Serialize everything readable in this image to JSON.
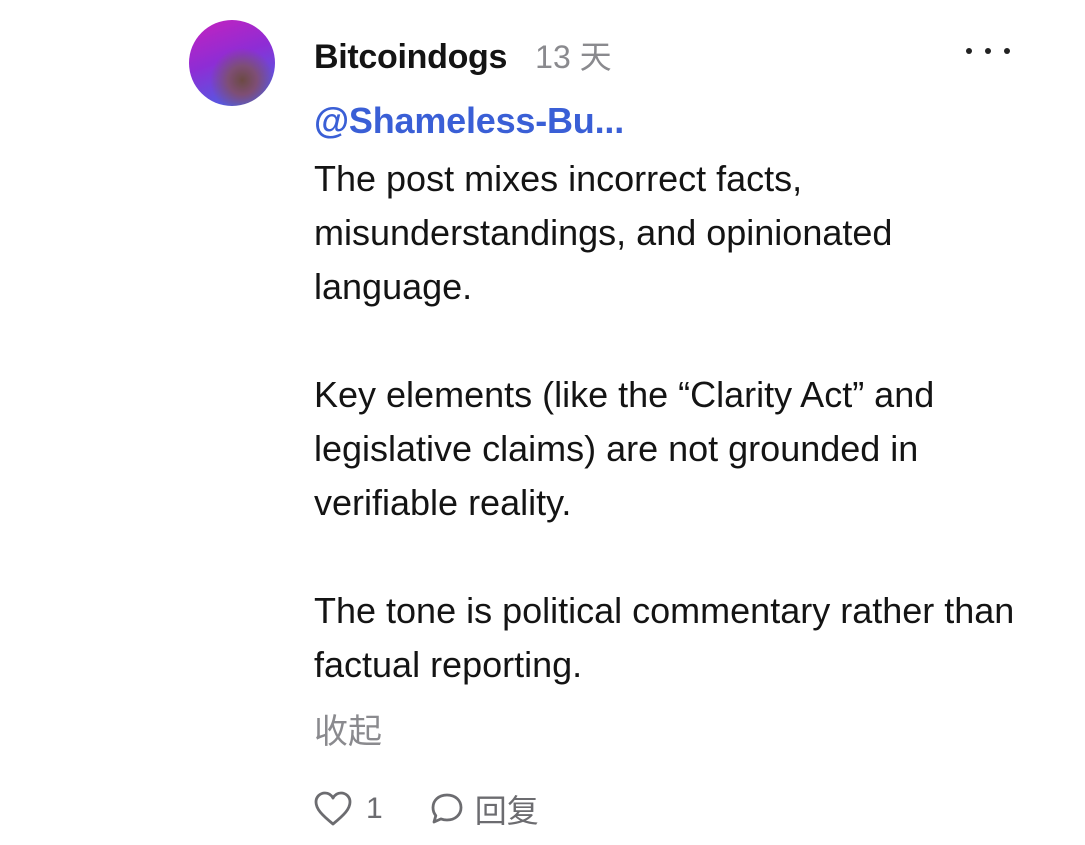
{
  "comment": {
    "username": "Bitcoindogs",
    "timestamp": "13 天",
    "mention": "@Shameless-Bu...",
    "paragraphs": [
      "The post mixes incorrect facts, misunderstandings, and opinionated language.",
      "Key elements (like the “Clarity Act” and legislative claims) are not grounded in verifiable reality.",
      "The tone is political commentary rather than factual reporting."
    ],
    "collapse_label": "收起",
    "like_count": "1",
    "reply_label": "回复"
  },
  "icons": {
    "more": "more-horizontal-icon",
    "like": "heart-icon",
    "reply": "comment-bubble-icon"
  },
  "colors": {
    "mention": "#3a5fd6",
    "muted": "#8a8a8e",
    "text": "#141414"
  }
}
